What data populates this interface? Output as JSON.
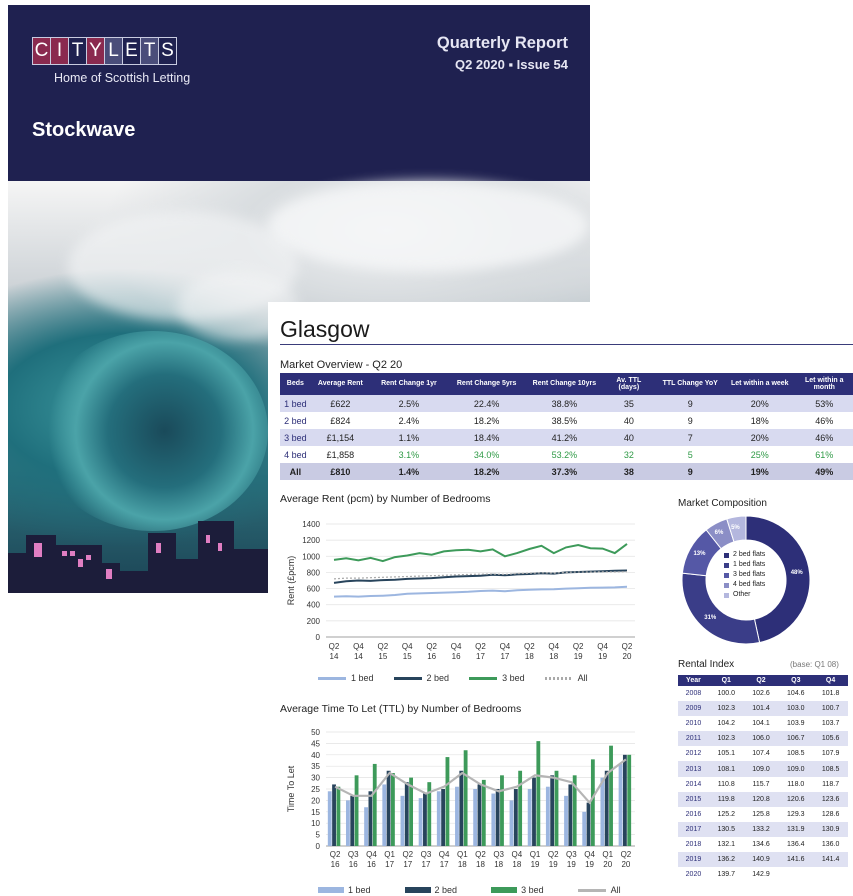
{
  "cover": {
    "logo_letters": [
      "C",
      "I",
      "T",
      "Y",
      "L",
      "E",
      "T",
      "S"
    ],
    "tagline": "Home of Scottish Letting",
    "title": "Stockwave",
    "report_label": "Quarterly Report",
    "issue_label": "Q2 2020 ▪ Issue 54"
  },
  "report": {
    "city": "Glasgow",
    "overview_title": "Market Overview - Q2 20",
    "overview_headers": [
      "Beds",
      "Average Rent",
      "Rent Change 1yr",
      "Rent Change 5yrs",
      "Rent Change 10yrs",
      "Av. TTL (days)",
      "TTL Change YoY",
      "Let within a week",
      "Let within a month"
    ],
    "overview_rows": [
      [
        "1 bed",
        "£622",
        "2.5%",
        "22.4%",
        "38.8%",
        "35",
        "9",
        "20%",
        "53%"
      ],
      [
        "2 bed",
        "£824",
        "2.4%",
        "18.2%",
        "38.5%",
        "40",
        "9",
        "18%",
        "46%"
      ],
      [
        "3 bed",
        "£1,154",
        "1.1%",
        "18.4%",
        "41.2%",
        "40",
        "7",
        "20%",
        "46%"
      ],
      [
        "4 bed",
        "£1,858",
        "3.1%",
        "34.0%",
        "53.2%",
        "32",
        "5",
        "25%",
        "61%"
      ],
      [
        "All",
        "£810",
        "1.4%",
        "18.2%",
        "37.3%",
        "38",
        "9",
        "19%",
        "49%"
      ]
    ],
    "rent_chart_title": "Average Rent (pcm) by Number of Bedrooms",
    "ttl_chart_title": "Average Time To Let (TTL) by Number of Bedrooms",
    "composition_title": "Market Composition",
    "composition_legend": [
      "2 bed flats",
      "1 bed flats",
      "3 bed flats",
      "4 bed flats",
      "Other"
    ],
    "rental_index_title": "Rental Index",
    "rental_index_base": "(base: Q1 08)",
    "rental_index_headers": [
      "Year",
      "Q1",
      "Q2",
      "Q3",
      "Q4"
    ],
    "rental_index_rows": [
      [
        "2008",
        "100.0",
        "102.6",
        "104.6",
        "101.8"
      ],
      [
        "2009",
        "102.3",
        "101.4",
        "103.0",
        "100.7"
      ],
      [
        "2010",
        "104.2",
        "104.1",
        "103.9",
        "103.7"
      ],
      [
        "2011",
        "102.3",
        "106.0",
        "106.7",
        "105.6"
      ],
      [
        "2012",
        "105.1",
        "107.4",
        "108.5",
        "107.9"
      ],
      [
        "2013",
        "108.1",
        "109.0",
        "109.0",
        "108.5"
      ],
      [
        "2014",
        "110.8",
        "115.7",
        "118.0",
        "118.7"
      ],
      [
        "2015",
        "119.8",
        "120.8",
        "120.6",
        "123.6"
      ],
      [
        "2016",
        "125.2",
        "125.8",
        "129.3",
        "128.6"
      ],
      [
        "2017",
        "130.5",
        "133.2",
        "131.9",
        "130.9"
      ],
      [
        "2018",
        "132.1",
        "134.6",
        "136.4",
        "136.0"
      ],
      [
        "2019",
        "136.2",
        "140.9",
        "141.6",
        "141.4"
      ],
      [
        "2020",
        "139.7",
        "142.9",
        "",
        ""
      ]
    ],
    "colors": {
      "navy": "#1f2150",
      "table_header": "#2d2f78",
      "bed1": "#9cb6e0",
      "bed2": "#28445c",
      "bed3": "#3d9a5a",
      "all": "#b5b5b5"
    }
  },
  "chart_data": [
    {
      "type": "line",
      "title": "Average Rent (pcm) by Number of Bedrooms",
      "ylabel": "Rent (£pcm)",
      "ylim": [
        0,
        1400
      ],
      "yticks": [
        "0",
        "200",
        "400",
        "600",
        "800",
        "1000",
        "1200",
        "1400"
      ],
      "categories": [
        "Q2 14",
        "Q3 14",
        "Q4 14",
        "Q1 15",
        "Q2 15",
        "Q3 15",
        "Q4 15",
        "Q1 16",
        "Q2 16",
        "Q3 16",
        "Q4 16",
        "Q1 17",
        "Q2 17",
        "Q3 17",
        "Q4 17",
        "Q1 18",
        "Q2 18",
        "Q3 18",
        "Q4 18",
        "Q1 19",
        "Q2 19",
        "Q3 19",
        "Q4 19",
        "Q1 20",
        "Q2 20"
      ],
      "tick_labels": [
        [
          "Q2",
          "14"
        ],
        [
          "Q4",
          "14"
        ],
        [
          "Q2",
          "15"
        ],
        [
          "Q4",
          "15"
        ],
        [
          "Q2",
          "16"
        ],
        [
          "Q4",
          "16"
        ],
        [
          "Q2",
          "17"
        ],
        [
          "Q4",
          "17"
        ],
        [
          "Q2",
          "18"
        ],
        [
          "Q4",
          "18"
        ],
        [
          "Q2",
          "19"
        ],
        [
          "Q4",
          "19"
        ],
        [
          "Q2",
          "20"
        ]
      ],
      "series": [
        {
          "name": "1 bed",
          "values": [
            500,
            505,
            500,
            508,
            512,
            520,
            535,
            540,
            545,
            550,
            555,
            560,
            570,
            575,
            568,
            580,
            585,
            590,
            592,
            600,
            605,
            610,
            612,
            615,
            622
          ]
        },
        {
          "name": "2 bed",
          "values": [
            670,
            690,
            700,
            695,
            705,
            710,
            720,
            725,
            730,
            740,
            750,
            755,
            760,
            770,
            765,
            775,
            780,
            790,
            785,
            800,
            805,
            810,
            815,
            820,
            824
          ]
        },
        {
          "name": "3 bed",
          "values": [
            955,
            975,
            950,
            980,
            940,
            990,
            1010,
            1040,
            1020,
            1060,
            1075,
            1080,
            1060,
            1085,
            1000,
            1040,
            1090,
            1130,
            1040,
            1110,
            1140,
            1100,
            1095,
            1040,
            1154
          ]
        },
        {
          "name": "All",
          "values": [
            720,
            730,
            730,
            735,
            740,
            745,
            750,
            755,
            760,
            765,
            770,
            775,
            778,
            780,
            775,
            785,
            790,
            795,
            792,
            800,
            805,
            805,
            808,
            806,
            810
          ]
        }
      ],
      "legend": [
        "1 bed",
        "2 bed",
        "3 bed",
        "All"
      ],
      "legend_position": "bottom"
    },
    {
      "type": "bar",
      "title": "Average Time To Let (TTL) by Number of Bedrooms",
      "ylabel": "Time To Let",
      "ylim": [
        0,
        50
      ],
      "yticks": [
        "0",
        "5",
        "10",
        "15",
        "20",
        "25",
        "30",
        "35",
        "40",
        "45",
        "50"
      ],
      "categories": [
        "Q2 16",
        "Q3 16",
        "Q4 16",
        "Q1 17",
        "Q2 17",
        "Q3 17",
        "Q4 17",
        "Q1 18",
        "Q2 18",
        "Q3 18",
        "Q4 18",
        "Q1 19",
        "Q2 19",
        "Q3 19",
        "Q4 19",
        "Q1 20",
        "Q2 20"
      ],
      "tick_labels": [
        [
          "Q2",
          "16"
        ],
        [
          "Q3",
          "16"
        ],
        [
          "Q4",
          "16"
        ],
        [
          "Q1",
          "17"
        ],
        [
          "Q2",
          "17"
        ],
        [
          "Q3",
          "17"
        ],
        [
          "Q4",
          "17"
        ],
        [
          "Q1",
          "18"
        ],
        [
          "Q2",
          "18"
        ],
        [
          "Q3",
          "18"
        ],
        [
          "Q4",
          "18"
        ],
        [
          "Q1",
          "19"
        ],
        [
          "Q2",
          "19"
        ],
        [
          "Q3",
          "19"
        ],
        [
          "Q4",
          "19"
        ],
        [
          "Q1",
          "20"
        ],
        [
          "Q2",
          "20"
        ]
      ],
      "series": [
        {
          "name": "1 bed",
          "values": [
            24,
            20,
            17,
            27,
            22,
            21,
            24,
            26,
            25,
            23,
            20,
            25,
            26,
            22,
            15,
            30,
            36
          ]
        },
        {
          "name": "2 bed",
          "values": [
            27,
            22,
            24,
            33,
            28,
            23,
            25,
            33,
            27,
            25,
            25,
            30,
            31,
            27,
            19,
            33,
            40
          ]
        },
        {
          "name": "3 bed",
          "values": [
            26,
            31,
            36,
            32,
            30,
            28,
            39,
            42,
            29,
            31,
            33,
            46,
            33,
            31,
            38,
            44,
            40
          ]
        },
        {
          "name": "All",
          "values": [
            26,
            22,
            22,
            32,
            27,
            23,
            26,
            32,
            27,
            24,
            26,
            31,
            30,
            28,
            19,
            32,
            38
          ]
        }
      ],
      "legend": [
        "1 bed",
        "2 bed",
        "3 bed",
        "All"
      ],
      "legend_position": "bottom"
    },
    {
      "type": "pie",
      "title": "Market Composition",
      "labels": [
        "2 bed flats",
        "1 bed flats",
        "3 bed flats",
        "4 bed flats",
        "Other"
      ],
      "values": [
        48,
        31,
        13,
        6,
        5
      ],
      "data_labels": [
        "48%",
        "31%",
        "13%",
        "6%",
        "5%"
      ]
    }
  ]
}
